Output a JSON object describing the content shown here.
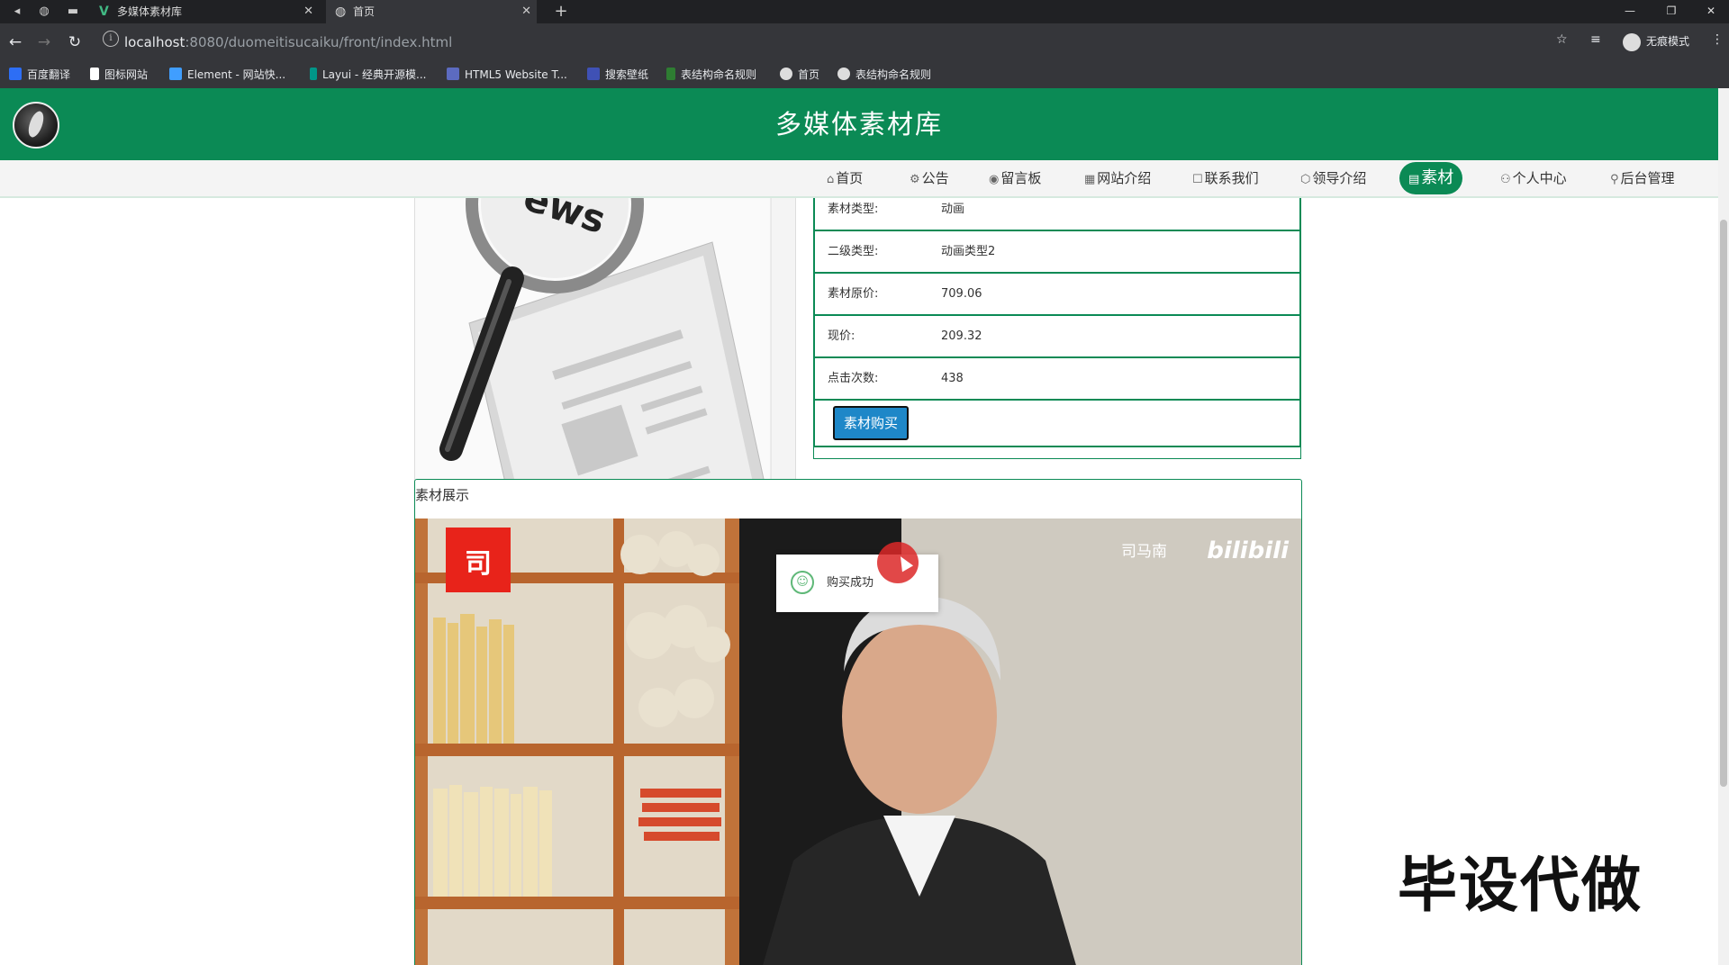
{
  "browser": {
    "tabs": [
      {
        "title": "多媒体素材库",
        "active": false
      },
      {
        "title": "首页",
        "active": true
      }
    ],
    "url_host": "localhost",
    "url_rest": ":8080/duomeitisucaiku/front/index.html",
    "incognito_label": "无痕模式",
    "bookmarks": [
      {
        "label": "百度翻译",
        "color": "#2d6ef5"
      },
      {
        "label": "图标网站",
        "color": "#ffffff"
      },
      {
        "label": "Element - 网站快...",
        "color": "#409eff"
      },
      {
        "label": "Layui - 经典开源模...",
        "color": "#009688"
      },
      {
        "label": "HTML5 Website T...",
        "color": "#5c6bc0"
      },
      {
        "label": "搜索壁纸",
        "color": "#3f51b5"
      },
      {
        "label": "表结构命名规则",
        "color": "#2e7d32"
      },
      {
        "label": "首页",
        "color": "#dddddd"
      },
      {
        "label": "表结构命名规则",
        "color": "#dddddd"
      }
    ]
  },
  "site": {
    "title": "多媒体素材库",
    "nav": [
      {
        "label": "首页",
        "icon": "⌂",
        "active": false
      },
      {
        "label": "公告",
        "icon": "⚙",
        "active": false
      },
      {
        "label": "留言板",
        "icon": "◉",
        "active": false
      },
      {
        "label": "网站介绍",
        "icon": "▦",
        "active": false
      },
      {
        "label": "联系我们",
        "icon": "☐",
        "active": false
      },
      {
        "label": "领导介绍",
        "icon": "⬡",
        "active": false
      },
      {
        "label": "素材",
        "icon": "▤",
        "active": true
      },
      {
        "label": "个人中心",
        "icon": "⚇",
        "active": false
      },
      {
        "label": "后台管理",
        "icon": "⚲",
        "active": false
      }
    ]
  },
  "detail": {
    "rows": [
      {
        "label": "素材类型:",
        "value": "动画"
      },
      {
        "label": "二级类型:",
        "value": "动画类型2"
      },
      {
        "label": "素材原价:",
        "value": "709.06"
      },
      {
        "label": "现价:",
        "value": "209.32"
      },
      {
        "label": "点击次数:",
        "value": "438"
      }
    ],
    "buy_button": "素材购买"
  },
  "showcase": {
    "title": "素材展示",
    "video_channel": "司马南",
    "video_brand": "bilibili",
    "video_logo": "司"
  },
  "toast": {
    "message": "购买成功"
  },
  "overlay_watermark": "毕设代做"
}
